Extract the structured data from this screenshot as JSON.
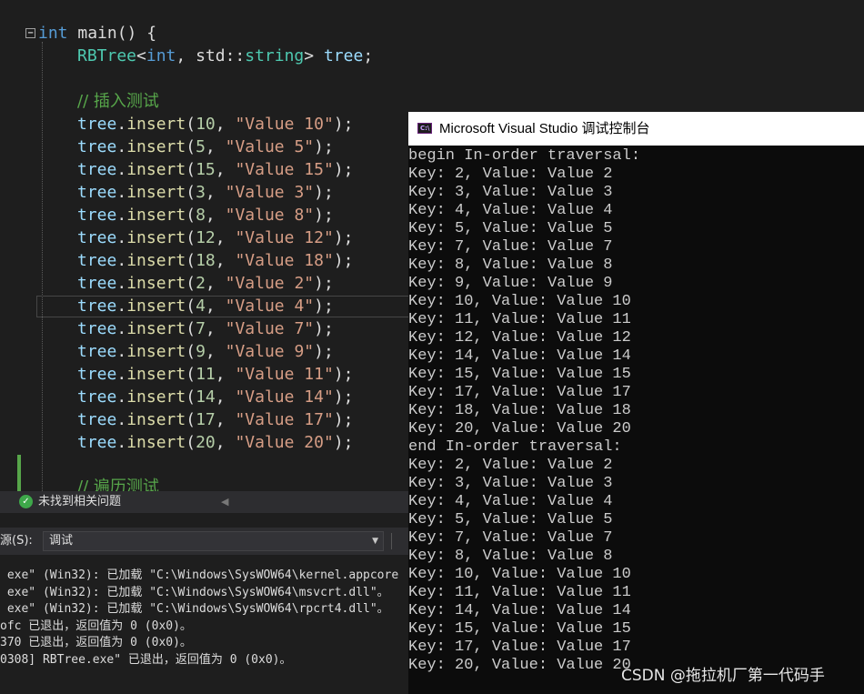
{
  "editor": {
    "collapse_glyph": "−",
    "comment_insert": "// 插入测试",
    "comment_traverse": "// 遍历测试",
    "main_keyword": "int",
    "main_sig": " main() {",
    "decl_type": "RBTree",
    "decl_args_open": "<",
    "decl_int": "int",
    "decl_mid": ", std::",
    "decl_string": "string",
    "decl_close": "> ",
    "decl_var": "tree",
    "decl_semi": ";",
    "insert_calls": [
      {
        "key": "10",
        "value": "\"Value 10\""
      },
      {
        "key": "5",
        "value": "\"Value 5\""
      },
      {
        "key": "15",
        "value": "\"Value 15\""
      },
      {
        "key": "3",
        "value": "\"Value 3\""
      },
      {
        "key": "8",
        "value": "\"Value 8\""
      },
      {
        "key": "12",
        "value": "\"Value 12\""
      },
      {
        "key": "18",
        "value": "\"Value 18\""
      },
      {
        "key": "2",
        "value": "\"Value 2\""
      },
      {
        "key": "4",
        "value": "\"Value 4\""
      },
      {
        "key": "7",
        "value": "\"Value 7\""
      },
      {
        "key": "9",
        "value": "\"Value 9\""
      },
      {
        "key": "11",
        "value": "\"Value 11\""
      },
      {
        "key": "14",
        "value": "\"Value 14\""
      },
      {
        "key": "17",
        "value": "\"Value 17\""
      },
      {
        "key": "20",
        "value": "\"Value 20\""
      }
    ],
    "current_line_index": 8
  },
  "error_strip": {
    "status_text": "未找到相关问题",
    "status_icon": "check-circle-icon",
    "scroll_arrow": "◀"
  },
  "output": {
    "source_label": "源(S):",
    "source_value": "调试",
    "lines": [
      " exe\" (Win32): 已加载 \"C:\\Windows\\SysWOW64\\kernel.appcore",
      " exe\" (Win32): 已加载 \"C:\\Windows\\SysWOW64\\msvcrt.dll\"。",
      " exe\" (Win32): 已加载 \"C:\\Windows\\SysWOW64\\rpcrt4.dll\"。",
      "ofc 已退出，返回值为 0 (0x0)。",
      "370 已退出，返回值为 0 (0x0)。",
      "0308] RBTree.exe\" 已退出，返回值为 0 (0x0)。"
    ]
  },
  "console": {
    "title": "Microsoft Visual Studio 调试控制台",
    "icon": "vs-console-icon",
    "lines": [
      "begin In-order traversal:",
      "Key: 2, Value: Value 2",
      "Key: 3, Value: Value 3",
      "Key: 4, Value: Value 4",
      "Key: 5, Value: Value 5",
      "Key: 7, Value: Value 7",
      "Key: 8, Value: Value 8",
      "Key: 9, Value: Value 9",
      "Key: 10, Value: Value 10",
      "Key: 11, Value: Value 11",
      "Key: 12, Value: Value 12",
      "Key: 14, Value: Value 14",
      "Key: 15, Value: Value 15",
      "Key: 17, Value: Value 17",
      "Key: 18, Value: Value 18",
      "Key: 20, Value: Value 20",
      "end In-order traversal:",
      "Key: 2, Value: Value 2",
      "Key: 3, Value: Value 3",
      "Key: 4, Value: Value 4",
      "Key: 5, Value: Value 5",
      "Key: 7, Value: Value 7",
      "Key: 8, Value: Value 8",
      "Key: 10, Value: Value 10",
      "Key: 11, Value: Value 11",
      "Key: 14, Value: Value 14",
      "Key: 15, Value: Value 15",
      "Key: 17, Value: Value 17",
      "Key: 20, Value: Value 20"
    ]
  },
  "watermark": "CSDN @拖拉机厂第一代码手",
  "colors": {
    "editor_bg": "#1e1e1e",
    "keyword": "#569cd6",
    "type": "#4ec9b0",
    "function": "#dcdcaa",
    "variable": "#9cdcfe",
    "number": "#b5cea8",
    "string": "#d69d85",
    "comment": "#57a64a",
    "console_bg": "#0c0c0c",
    "console_text": "#cccccc"
  }
}
